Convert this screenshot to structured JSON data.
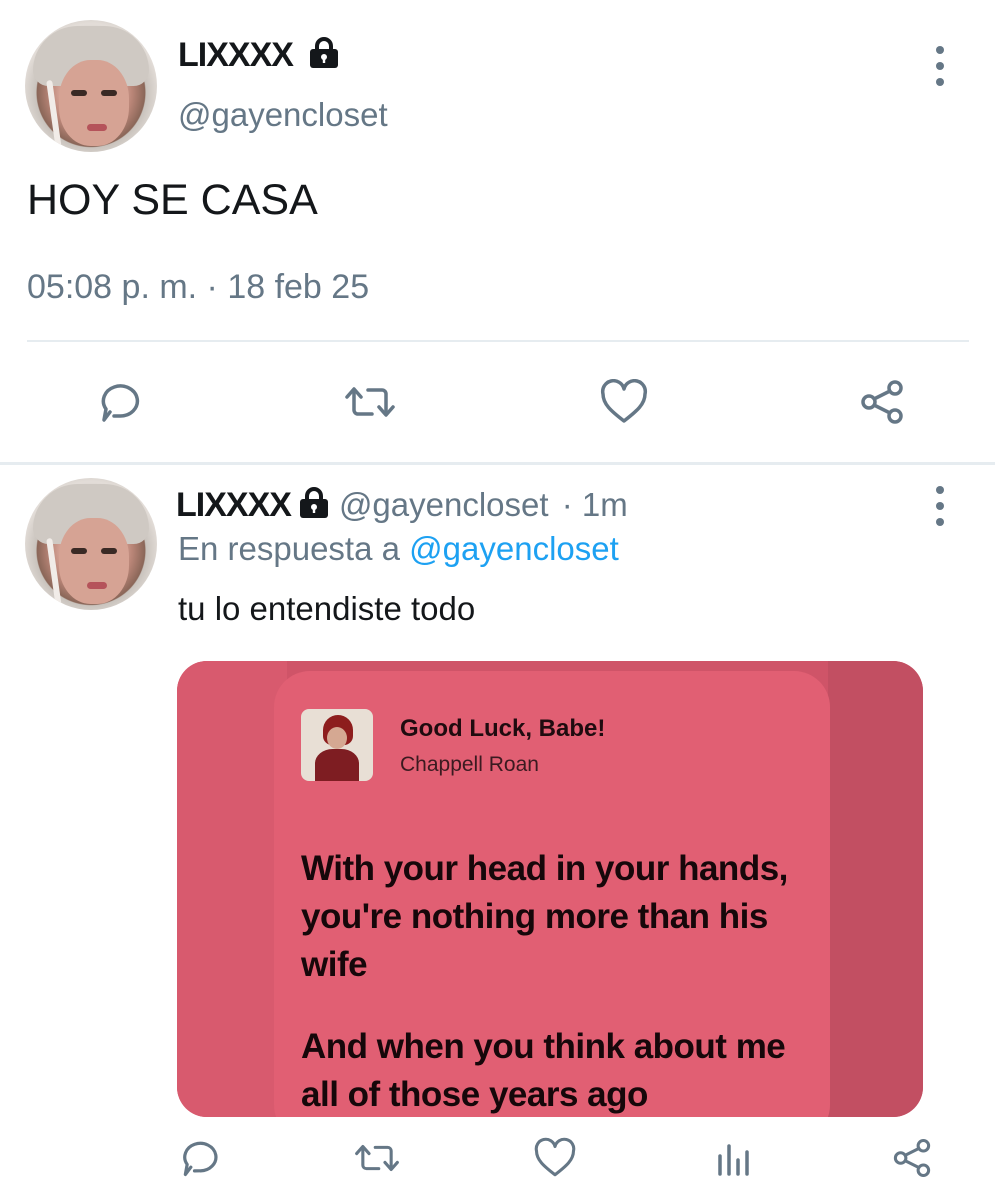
{
  "main_tweet": {
    "display_name": "LIXXXX",
    "handle": "@gayencloset",
    "text": "HOY SE CASA",
    "timestamp": "05:08 p. m. · 18 feb 25",
    "icons": {
      "reply": "reply-icon",
      "retweet": "retweet-icon",
      "like": "heart-icon",
      "share": "share-icon",
      "more": "more-vertical-icon",
      "lock": "lock-icon"
    }
  },
  "reply_tweet": {
    "display_name": "LIXXXX",
    "handle": "@gayencloset",
    "time_ago": "· 1m",
    "in_reply_prefix": "En respuesta a",
    "in_reply_handle": "@gayencloset",
    "text": "tu lo entendiste todo",
    "media": {
      "song_title": "Good Luck, Babe!",
      "artist": "Chappell Roan",
      "lyrics_1": "With your head in your hands, you're nothing more than his wife",
      "lyrics_2": "And when you think about me all of those years ago"
    },
    "icons": {
      "reply": "reply-icon",
      "retweet": "retweet-icon",
      "like": "heart-icon",
      "analytics": "analytics-icon",
      "share": "share-icon",
      "more": "more-vertical-icon"
    }
  },
  "colors": {
    "primary_text": "#14171a",
    "secondary_text": "#657786",
    "link": "#1da1f2",
    "media_bg": "#cf5468",
    "lyric_card": "#e15f73"
  }
}
